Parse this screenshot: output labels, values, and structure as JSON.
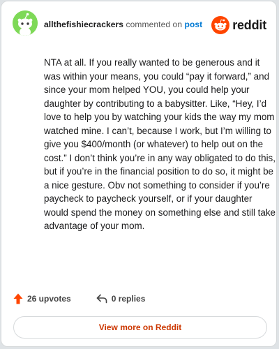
{
  "header": {
    "username": "allthefishiecrackers",
    "action_text": "commented on",
    "post_link": "post"
  },
  "brand": {
    "logo_icon": "reddit-logo-icon",
    "wordmark": "reddit",
    "accent_color": "#ff4500"
  },
  "comment": {
    "body": "NTA at all. If you really wanted to be generous and it was within your means, you could “pay it forward,” and since your mom helped YOU, you could help your daughter by contributing to a babysitter. Like, “Hey, I’d love to help you by watching your kids the way my mom watched mine. I can’t, because I work, but I’m willing to give you $400/month (or whatever) to help out on the cost.” I don’t think you’re in any way obligated to do this, but if you’re in the financial position to do so, it might be a nice gesture. Obv not something to consider if you’re paycheck to paycheck yourself, or if your daughter would spend the money on something else and still take advantage of your mom."
  },
  "stats": {
    "upvotes_icon": "upvote-arrow-icon",
    "upvotes": "26 upvotes",
    "replies_icon": "reply-icon",
    "replies": "0 replies"
  },
  "footer": {
    "view_more_label": "View more on Reddit"
  }
}
